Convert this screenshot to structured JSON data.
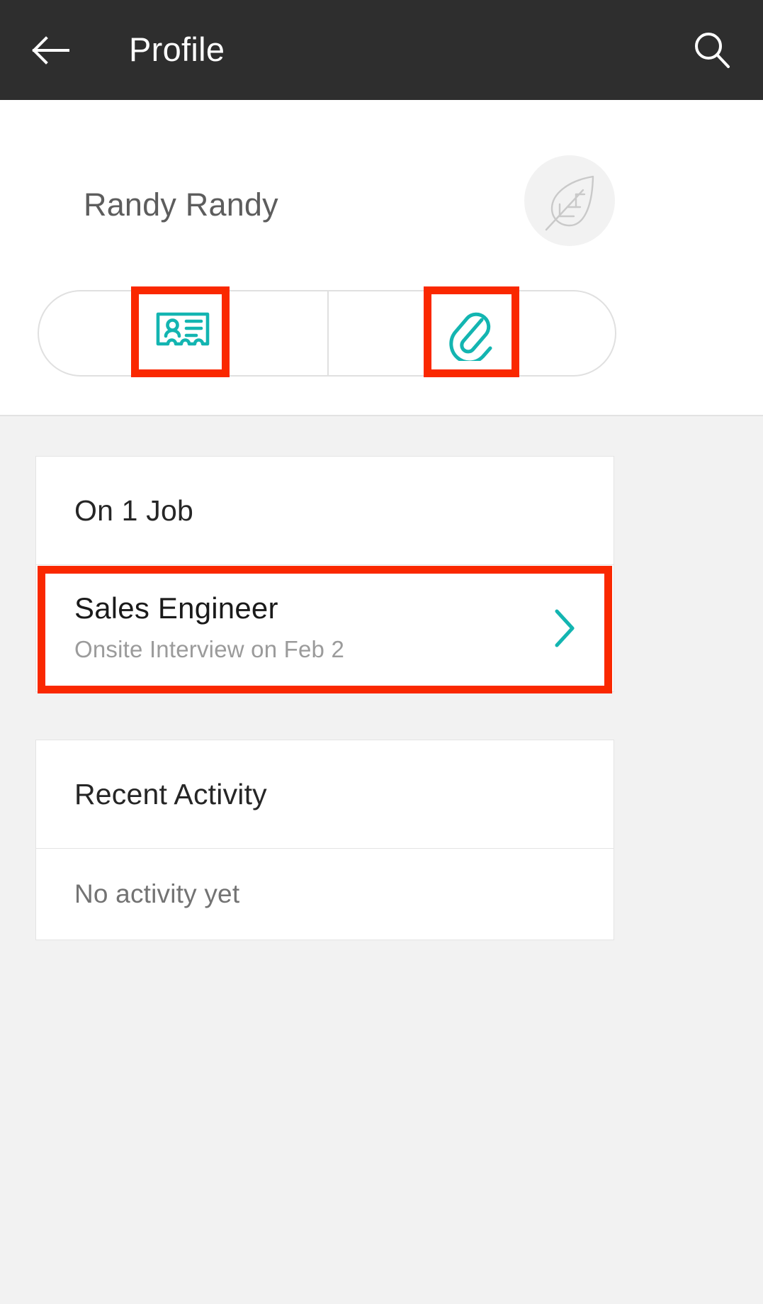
{
  "appbar": {
    "title": "Profile",
    "back_icon": "arrow-left-icon",
    "search_icon": "search-icon",
    "background_color": "#2e2e2e",
    "text_color": "#ffffff"
  },
  "profile": {
    "name": "Randy Randy",
    "avatar_icon": "leaf-icon",
    "avatar_background_color": "#f2f2f2"
  },
  "tabs": {
    "accent_color": "#13b5b1",
    "items": [
      {
        "icon": "contact-card-icon",
        "name": "tab-details",
        "selected": true
      },
      {
        "icon": "paperclip-icon",
        "name": "tab-attachments",
        "selected": false
      }
    ]
  },
  "jobs_card": {
    "header": "On 1 Job",
    "rows": [
      {
        "title": "Sales Engineer",
        "subtitle": "Onsite Interview on Feb 2",
        "chevron_icon": "chevron-right-icon",
        "chevron_color": "#13b5b1"
      }
    ]
  },
  "activity_card": {
    "header": "Recent Activity",
    "empty_text": "No activity yet"
  },
  "annotations": {
    "color": "#fa2800",
    "boxes": [
      {
        "name": "highlight-tab-details"
      },
      {
        "name": "highlight-tab-attachments"
      },
      {
        "name": "highlight-job-row"
      }
    ]
  }
}
